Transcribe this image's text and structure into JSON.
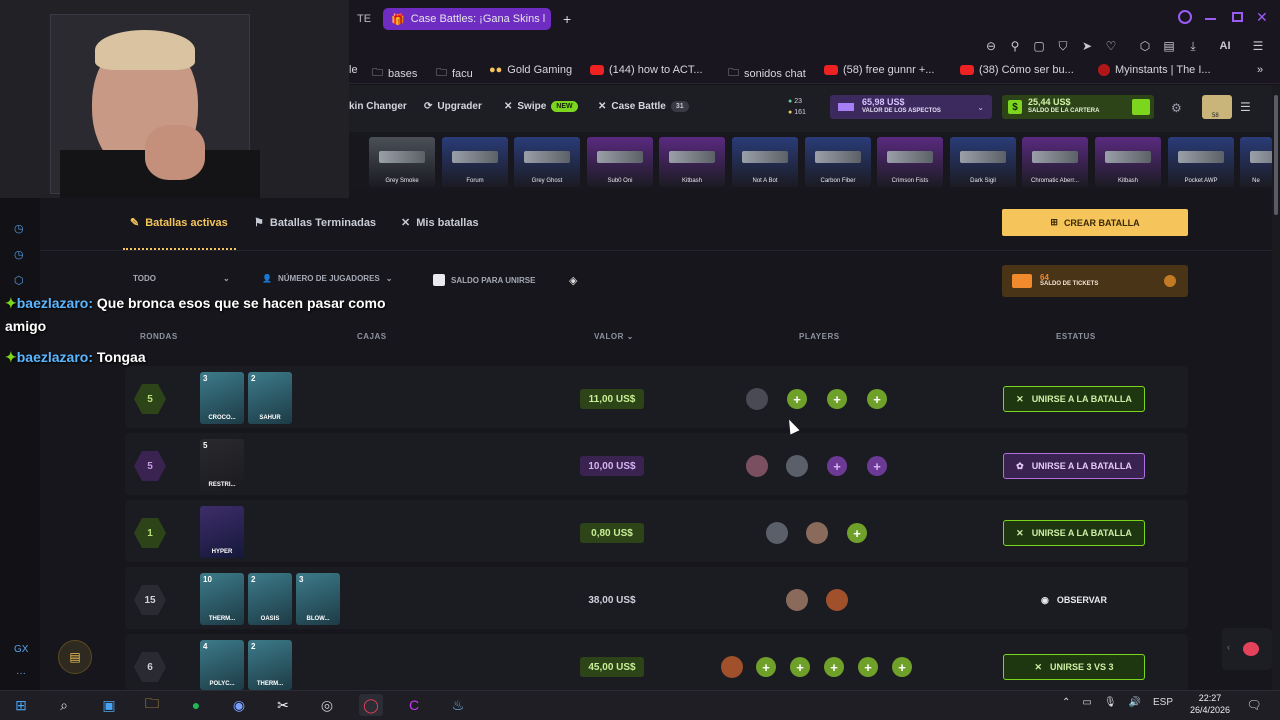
{
  "browser": {
    "partial_tab": "TE R",
    "active_tab": "Case Battles: ¡Gana Skins l",
    "new_tab": "+",
    "bookmarks": [
      {
        "label": "le",
        "icon": "none"
      },
      {
        "label": "bases",
        "icon": "folder-icon"
      },
      {
        "label": "facu",
        "icon": "folder-icon"
      },
      {
        "label": "Gold Gaming",
        "icon": "gold-icon"
      },
      {
        "label": "(144) how to ACT...",
        "icon": "youtube-icon"
      },
      {
        "label": "sonidos chat",
        "icon": "folder-icon"
      },
      {
        "label": "(58) free gunnr +...",
        "icon": "youtube-icon"
      },
      {
        "label": "(38) Cómo ser bu...",
        "icon": "youtube-icon"
      },
      {
        "label": "Myinstants | The I...",
        "icon": "myinstants-icon"
      }
    ],
    "toolbar_ai": "AI"
  },
  "site": {
    "nav": [
      {
        "label": "kin Changer"
      },
      {
        "label": "Upgrader"
      },
      {
        "label": "Swipe",
        "badge": "NEW"
      },
      {
        "label": "Case Battle",
        "count": "31"
      }
    ],
    "coins": {
      "green": "23",
      "gold": "161"
    },
    "skins_value": {
      "amount": "65,98 US$",
      "label": "VALOR DE LOS ASPECTOS"
    },
    "wallet": {
      "amount": "25,44 US$",
      "label": "SALDO DE LA CARTERA"
    },
    "avatar_level": "58"
  },
  "strip": [
    {
      "name": "Grey Smoke",
      "color": "#4a4f58"
    },
    {
      "name": "Forum",
      "color": "#2a3c78"
    },
    {
      "name": "Grey Ghost",
      "color": "#2a3c78"
    },
    {
      "name": "Sub0 Oni",
      "color": "#5a2a80"
    },
    {
      "name": "Kitbash",
      "color": "#5a2a80"
    },
    {
      "name": "Not A Bot",
      "color": "#2a3c78"
    },
    {
      "name": "Carbon Fiber",
      "color": "#2a3c78"
    },
    {
      "name": "Crimson Fists",
      "color": "#5a2a80"
    },
    {
      "name": "Dark Sigil",
      "color": "#2a3c78"
    },
    {
      "name": "Chromatic Aberr...",
      "color": "#5a2a80"
    },
    {
      "name": "Kitbash",
      "color": "#5a2a80"
    },
    {
      "name": "Pocket AWP",
      "color": "#2a3c78"
    },
    {
      "name": "Ne",
      "color": "#2a3c78"
    }
  ],
  "tabs": {
    "active": "Batallas activas",
    "finished": "Batallas Terminadas",
    "mine": "Mis batallas"
  },
  "create_battle": "CREAR BATALLA",
  "filters": {
    "all": "TODO",
    "players": "NÚMERO DE JUGADORES",
    "balance_join": "SALDO PARA UNIRSE"
  },
  "tickets": {
    "count": "64",
    "label": "SALDO DE TICKETS"
  },
  "columns": {
    "rounds": "RONDAS",
    "cases": "CAJAS",
    "value": "VALOR",
    "players": "PLAYERS",
    "status": "ESTATUS"
  },
  "battles": [
    {
      "rounds": "5",
      "theme": "green",
      "cases": [
        {
          "qty": "3",
          "label": "CROCO..."
        },
        {
          "qty": "2",
          "label": "SAHUR"
        }
      ],
      "value": "11,00 US$",
      "players": {
        "filled": 1,
        "open": 3
      },
      "action": "UNIRSE A LA BATALLA"
    },
    {
      "rounds": "5",
      "theme": "purple",
      "cases": [
        {
          "qty": "5",
          "label": "RESTRI..."
        }
      ],
      "value": "10,00 US$",
      "players": {
        "filled": 2,
        "open": 2
      },
      "action": "UNIRSE A LA BATALLA"
    },
    {
      "rounds": "1",
      "theme": "green",
      "cases": [
        {
          "qty": "",
          "label": "HYPER"
        }
      ],
      "value": "0,80 US$",
      "players": {
        "filled": 2,
        "open": 1
      },
      "action": "UNIRSE A LA BATALLA"
    },
    {
      "rounds": "15",
      "theme": "gray",
      "cases": [
        {
          "qty": "10",
          "label": "THERM..."
        },
        {
          "qty": "2",
          "label": "OASIS"
        },
        {
          "qty": "3",
          "label": "BLOW..."
        }
      ],
      "value": "38,00 US$",
      "players": {
        "filled": 2,
        "open": 0
      },
      "action": "OBSERVAR"
    },
    {
      "rounds": "6",
      "theme": "gray-green",
      "cases": [
        {
          "qty": "4",
          "label": "POLYC..."
        },
        {
          "qty": "2",
          "label": "THERM..."
        }
      ],
      "value": "45,00 US$",
      "players": {
        "filled": 1,
        "open": 5
      },
      "action": "UNIRSE 3 VS 3"
    }
  ],
  "chat": [
    {
      "user": "baezlazaro:",
      "text": "Que bronca esos que se hacen pasar como"
    },
    {
      "user": "",
      "text": "amigo"
    },
    {
      "user": "baezlazaro:",
      "text": "Tongaa"
    }
  ],
  "sidebar_bottom": "GX",
  "taskbar": {
    "lang": "ESP",
    "time": "22:27",
    "date": "26/4/2026"
  },
  "colors": {
    "green": "#7dd61e",
    "purple": "#b06fe0",
    "gold": "#f5c45a"
  }
}
